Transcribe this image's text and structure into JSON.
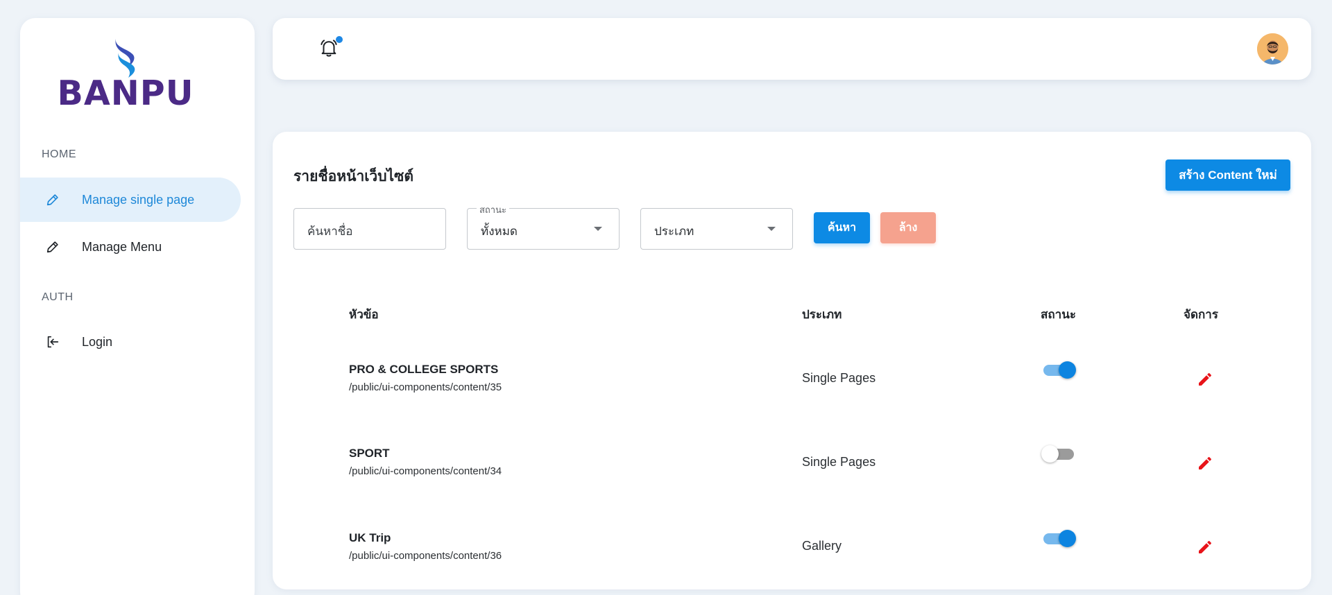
{
  "brand": {
    "logo_text": "BANPU"
  },
  "sidebar": {
    "sections": [
      {
        "label": "HOME"
      },
      {
        "label": "AUTH"
      }
    ],
    "items": [
      {
        "label": "Manage single page",
        "icon": "pencil-icon",
        "active": true
      },
      {
        "label": "Manage Menu",
        "icon": "pencil-icon",
        "active": false
      },
      {
        "label": "Login",
        "icon": "login-icon",
        "active": false
      }
    ]
  },
  "header": {
    "icons": [
      "bell-icon",
      "avatar"
    ]
  },
  "page": {
    "title": "รายชื่อหน้าเว็บไซต์",
    "create_button": "สร้าง Content ใหม่"
  },
  "filters": {
    "search_placeholder": "ค้นหาชื่อ",
    "status": {
      "label": "สถานะ",
      "value": "ทั้งหมด"
    },
    "type": {
      "value": "ประเภท"
    },
    "search_button": "ค้นหา",
    "clear_button": "ล้าง"
  },
  "table": {
    "headers": [
      "หัวข้อ",
      "ประเภท",
      "สถานะ",
      "จัดการ"
    ],
    "rows": [
      {
        "title": "PRO & COLLEGE SPORTS",
        "path": "/public/ui-components/content/35",
        "type": "Single Pages",
        "enabled": true
      },
      {
        "title": "SPORT",
        "path": "/public/ui-components/content/34",
        "type": "Single Pages",
        "enabled": false
      },
      {
        "title": "UK Trip",
        "path": "/public/ui-components/content/36",
        "type": "Gallery",
        "enabled": true
      }
    ]
  },
  "colors": {
    "primary": "#0d8ae4",
    "clear": "#f5a28e",
    "brand": "#4b2a86",
    "edit": "#e8141a",
    "background": "#eef3f8"
  }
}
